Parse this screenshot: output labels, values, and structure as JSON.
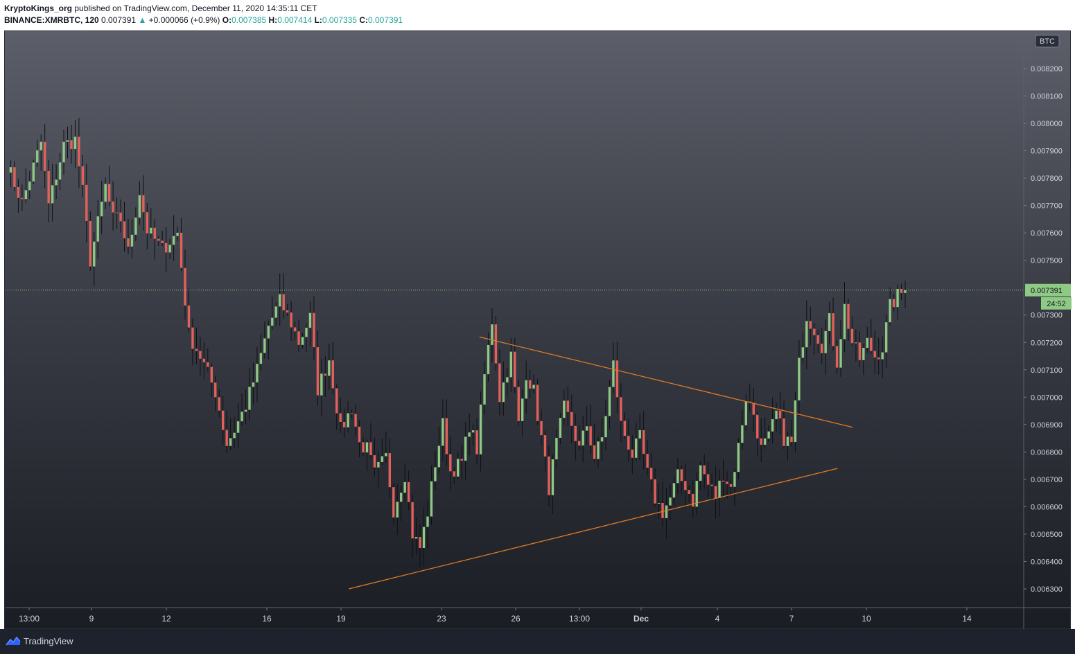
{
  "header": {
    "author": "KryptoKings_org",
    "published_text": "published on TradingView.com, December 11, 2020 14:35:11 CET",
    "symbol": "BINANCE:XMRBTC, 120",
    "last": "0.007391",
    "change": "+0.000066 (+0.9%)",
    "o_label": "O:",
    "o_value": "0.007385",
    "h_label": "H:",
    "h_value": "0.007414",
    "l_label": "L:",
    "l_value": "0.007335",
    "c_label": "C:",
    "c_value": "0.007391"
  },
  "footer": {
    "brand": "TradingView"
  },
  "colors": {
    "up": "#8fca84",
    "down": "#e3615a",
    "wick": "#0d0f12",
    "trendline": "#e07a27",
    "price_line": "#8fca84",
    "axis_text": "#d1d4dc"
  },
  "chart_data": {
    "type": "candlestick",
    "currency_badge": "BTC",
    "last_price_label": "0.007391",
    "countdown_label": "24:52",
    "last_price": 0.007391,
    "y_ticks": [
      "0.008200",
      "0.008100",
      "0.008000",
      "0.007900",
      "0.007800",
      "0.007700",
      "0.007600",
      "0.007500",
      "0.007300",
      "0.007200",
      "0.007100",
      "0.007000",
      "0.006900",
      "0.006800",
      "0.006700",
      "0.006600",
      "0.006500",
      "0.006400",
      "0.006300"
    ],
    "ylim": [
      0.00625,
      0.00832
    ],
    "x_ticks": [
      "13:00",
      "9",
      "12",
      "16",
      "19",
      "23",
      "26",
      "13:00",
      "Dec",
      "4",
      "7",
      "10",
      "14"
    ],
    "bar_count": 160,
    "anchors": [
      [
        0,
        0.00785
      ],
      [
        4,
        0.00771
      ],
      [
        9,
        0.00793
      ],
      [
        11,
        0.0077
      ],
      [
        15,
        0.00792
      ],
      [
        18,
        0.00794
      ],
      [
        20,
        0.00775
      ],
      [
        22,
        0.0075
      ],
      [
        26,
        0.00777
      ],
      [
        28,
        0.00765
      ],
      [
        30,
        0.00765
      ],
      [
        32,
        0.00753
      ],
      [
        35,
        0.00775
      ],
      [
        37,
        0.00761
      ],
      [
        41,
        0.00754
      ],
      [
        45,
        0.0076
      ],
      [
        48,
        0.00723
      ],
      [
        51,
        0.00715
      ],
      [
        55,
        0.00702
      ],
      [
        58,
        0.00683
      ],
      [
        60,
        0.00688
      ],
      [
        63,
        0.00697
      ],
      [
        66,
        0.0071
      ],
      [
        69,
        0.00726
      ],
      [
        72,
        0.00735
      ],
      [
        75,
        0.00727
      ],
      [
        77,
        0.0072
      ],
      [
        80,
        0.00729
      ],
      [
        82,
        0.00703
      ],
      [
        85,
        0.00714
      ],
      [
        88,
        0.00688
      ],
      [
        91,
        0.00696
      ],
      [
        93,
        0.00683
      ],
      [
        95,
        0.00681
      ],
      [
        97,
        0.00672
      ],
      [
        100,
        0.00678
      ],
      [
        102,
        0.00659
      ],
      [
        105,
        0.00672
      ],
      [
        107,
        0.0065
      ],
      [
        109,
        0.00645
      ],
      [
        111,
        0.00658
      ],
      [
        113,
        0.00676
      ],
      [
        115,
        0.0069
      ],
      [
        117,
        0.00673
      ],
      [
        120,
        0.00676
      ],
      [
        122,
        0.0069
      ],
      [
        124,
        0.00681
      ],
      [
        126,
        0.00708
      ],
      [
        128,
        0.00728
      ],
      [
        130,
        0.007
      ],
      [
        133,
        0.00715
      ],
      [
        135,
        0.0069
      ],
      [
        137,
        0.00709
      ],
      [
        139,
        0.00702
      ],
      [
        141,
        0.00685
      ],
      [
        143,
        0.00667
      ],
      [
        145,
        0.00683
      ],
      [
        147,
        0.00696
      ],
      [
        149,
        0.0069
      ],
      [
        151,
        0.00681
      ],
      [
        153,
        0.0069
      ],
      [
        155,
        0.00678
      ],
      [
        157,
        0.00685
      ],
      [
        160,
        0.00712
      ]
    ],
    "extra_anchors": [
      [
        0,
        0.00712
      ],
      [
        2,
        0.0069
      ],
      [
        5,
        0.00679
      ],
      [
        7,
        0.00685
      ],
      [
        9,
        0.00672
      ],
      [
        11,
        0.00663
      ],
      [
        13,
        0.00658
      ],
      [
        15,
        0.00663
      ],
      [
        17,
        0.00671
      ],
      [
        19,
        0.00668
      ],
      [
        21,
        0.00662
      ],
      [
        23,
        0.00675
      ],
      [
        25,
        0.00668
      ],
      [
        27,
        0.00664
      ],
      [
        29,
        0.00672
      ],
      [
        31,
        0.00667
      ],
      [
        33,
        0.00682
      ],
      [
        35,
        0.007
      ],
      [
        37,
        0.00694
      ],
      [
        39,
        0.00681
      ],
      [
        41,
        0.00685
      ],
      [
        43,
        0.00694
      ],
      [
        45,
        0.00685
      ],
      [
        47,
        0.00683
      ],
      [
        49,
        0.00712
      ],
      [
        51,
        0.0073
      ],
      [
        53,
        0.00725
      ],
      [
        55,
        0.00719
      ],
      [
        57,
        0.00728
      ],
      [
        59,
        0.00713
      ],
      [
        61,
        0.00733
      ],
      [
        63,
        0.0072
      ],
      [
        65,
        0.00714
      ],
      [
        67,
        0.0072
      ],
      [
        69,
        0.00715
      ],
      [
        71,
        0.00718
      ],
      [
        73,
        0.00733
      ],
      [
        75,
        0.00737
      ],
      [
        77,
        0.00739
      ]
    ],
    "trendlines": [
      {
        "name": "upper",
        "from": [
          0.00722,
          0.4655
        ],
        "to": [
          0.00689,
          0.8319
        ]
      },
      {
        "name": "lower",
        "from": [
          0.0063,
          0.3372
        ],
        "to": [
          0.00674,
          0.817
        ]
      }
    ]
  }
}
